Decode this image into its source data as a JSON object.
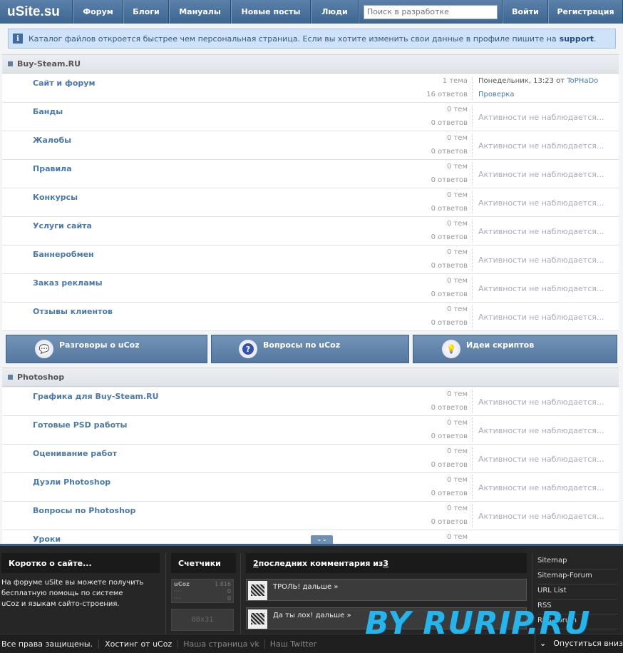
{
  "nav": {
    "logo": "uSite.su",
    "items": [
      "Форум",
      "Блоги",
      "Мануалы",
      "Новые посты",
      "Люди"
    ],
    "search_placeholder": "Поиск в разработке",
    "login": "Войти",
    "register": "Регистрация"
  },
  "info": {
    "text": "Каталог файлов откроется быстрее чем персональная страница. Если вы хотите изменить свои данные в профиле пишите на",
    "link": "support",
    "tail": "."
  },
  "sections": [
    {
      "title": "Buy-Steam.RU",
      "forums": [
        {
          "name": "Сайт и форум",
          "topics": "1 тема",
          "posts": "16 ответов",
          "last_time": "Понедельник, 13:23 от",
          "last_user": "ToPHaDo",
          "last_title": "Проверка"
        },
        {
          "name": "Банды",
          "topics": "0 тем",
          "posts": "0 ответов",
          "last": "Активности не наблюдается..."
        },
        {
          "name": "Жалобы",
          "topics": "0 тем",
          "posts": "0 ответов",
          "last": "Активности не наблюдается..."
        },
        {
          "name": "Правила",
          "topics": "0 тем",
          "posts": "0 ответов",
          "last": "Активности не наблюдается..."
        },
        {
          "name": "Конкурсы",
          "topics": "0 тем",
          "posts": "0 ответов",
          "last": "Активности не наблюдается..."
        },
        {
          "name": "Услуги сайта",
          "topics": "0 тем",
          "posts": "0 ответов",
          "last": "Активности не наблюдается..."
        },
        {
          "name": "Баннеробмен",
          "topics": "0 тем",
          "posts": "0 ответов",
          "last": "Активности не наблюдается..."
        },
        {
          "name": "Заказ рекламы",
          "topics": "0 тем",
          "posts": "0 ответов",
          "last": "Активности не наблюдается..."
        },
        {
          "name": "Отзывы клиентов",
          "topics": "0 тем",
          "posts": "0 ответов",
          "last": "Активности не наблюдается..."
        }
      ]
    },
    {
      "title": "Photoshop",
      "forums": [
        {
          "name": "Графика для Buy-Steam.RU",
          "topics": "0 тем",
          "posts": "0 ответов",
          "last": "Активности не наблюдается..."
        },
        {
          "name": "Готовые PSD работы",
          "topics": "0 тем",
          "posts": "0 ответов",
          "last": "Активности не наблюдается..."
        },
        {
          "name": "Оценивание работ",
          "topics": "0 тем",
          "posts": "0 ответов",
          "last": "Активности не наблюдается..."
        },
        {
          "name": "Дуэли Photoshop",
          "topics": "0 тем",
          "posts": "0 ответов",
          "last": "Активности не наблюдается..."
        },
        {
          "name": "Вопросы по Photoshop",
          "topics": "0 тем",
          "posts": "0 ответов",
          "last": "Активности не наблюдается..."
        },
        {
          "name": "Уроки",
          "topics": "0 тем",
          "posts": "",
          "last": "Активности не наблюдается..."
        }
      ]
    }
  ],
  "big_buttons": [
    {
      "label": "Разговоры о uCoz",
      "icon": "speech-bubble-icon"
    },
    {
      "label": "Вопросы по uCoz",
      "icon": "question-icon"
    },
    {
      "label": "Идеи скриптов",
      "icon": "lightbulb-icon"
    }
  ],
  "footer": {
    "about_title": "Коротко о сайте...",
    "about_text": [
      "На форуме uSite вы можете получить",
      "бесплатную помощь по системе",
      "uCoz и языкам сайто-строения."
    ],
    "counters_title": "Счетчики",
    "counter1": {
      "brand": "uCoz",
      "value1": "1 816",
      "value2": "0",
      "value3": "0"
    },
    "counter2": "88x31",
    "comments_title": {
      "count": "2",
      "middle": " последних комментария из ",
      "total": "3"
    },
    "comments": [
      "ТРОЛЬ! дальше »",
      "Да ты лох! дальше »"
    ],
    "links": [
      "Sitemap",
      "Sitemap-Forum",
      "URL List",
      "RSS",
      "RSS-Forum"
    ],
    "bottom": [
      "Все права защищены.",
      "Хостинг от uCoz",
      "Наша страница vk",
      "Наш Twitter"
    ],
    "scroll_down": "Опуститься вниз",
    "watermark": "BY RURIP.RU"
  }
}
